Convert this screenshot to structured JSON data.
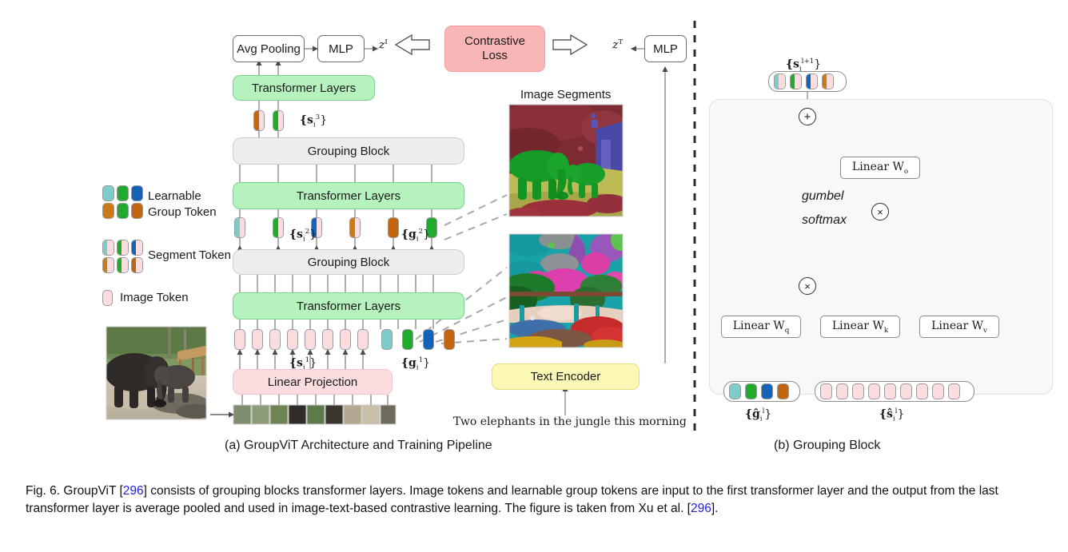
{
  "figure": {
    "number": "Fig. 6.",
    "caption_part1": "GroupViT [",
    "citation1": "296",
    "caption_part2": "] consists of grouping blocks transformer layers. Image tokens and learnable group tokens are input to the first transformer layer and the output from the last transformer layer is average pooled and used in image-text-based contrastive learning. The figure is taken from Xu et al. [",
    "citation2": "296",
    "caption_part3": "]."
  },
  "subcaptions": {
    "a": "(a) GroupViT Architecture and Training Pipeline",
    "b": "(b) Grouping Block"
  },
  "panel_a": {
    "avg_pooling": "Avg Pooling",
    "mlp_image": "MLP",
    "mlp_text": "MLP",
    "z_image": "z",
    "z_image_sup": "I",
    "z_text": "z",
    "z_text_sup": "T",
    "contrastive_loss_line1": "Contrastive",
    "contrastive_loss_line2": "Loss",
    "transformer_layers_top": "Transformer Layers",
    "transformer_layers_mid": "Transformer Layers",
    "transformer_layers_bot": "Transformer Layers",
    "grouping_block_top": "Grouping Block",
    "grouping_block_bot": "Grouping Block",
    "linear_projection": "Linear Projection",
    "text_encoder": "Text Encoder",
    "text_caption": "Two elephants in the jungle this morning",
    "image_segments_title": "Image Segments",
    "label_s3": "{s",
    "label_s3_sub": "i",
    "label_s3_sup": "3",
    "label_s2": "{s",
    "label_s2_sub": "i",
    "label_s2_sup": "2",
    "label_g2": "{g",
    "label_g2_sub": "i",
    "label_g2_sup": "2",
    "label_s1": "{s",
    "label_s1_sub": "i",
    "label_s1_sup": "1",
    "label_g1": "{g",
    "label_g1_sub": "i",
    "label_g1_sup": "1",
    "brace_close": "}"
  },
  "panel_b": {
    "output_label": "{s",
    "output_sub": "i",
    "output_sup": "l+1",
    "linear_wo": "Linear W",
    "linear_wo_sub": "o",
    "linear_wq": "Linear W",
    "linear_wq_sub": "q",
    "linear_wk": "Linear W",
    "linear_wk_sub": "k",
    "linear_wv": "Linear W",
    "linear_wv_sub": "v",
    "gumbel": "gumbel",
    "softmax": "softmax",
    "plus_op": "+",
    "times_op": "×",
    "input_g_label": "{ĝ",
    "input_g_sub": "i",
    "input_g_sup": "l",
    "input_s_label": "{ŝ",
    "input_s_sub": "i",
    "input_s_sup": "l",
    "brace_close": "}"
  },
  "legend": {
    "items": [
      {
        "name": "learnable-group-token",
        "label_line1": "Learnable",
        "label_line2": "Group Token"
      },
      {
        "name": "segment-token",
        "label_line1": "Segment Token",
        "label_line2": ""
      },
      {
        "name": "image-token",
        "label_line1": "Image Token",
        "label_line2": ""
      }
    ]
  },
  "colors": {
    "teal": "#7ecbc9",
    "green": "#22aa2e",
    "blue": "#1563b8",
    "orange": "#cc7a16",
    "orange_dark": "#c4640e",
    "image_token_pink": "#fbdde0",
    "contrastive_loss_bg": "#f9b6b6",
    "transformer_bg": "#b6f2be",
    "grouping_bg": "#ecedef",
    "linear_proj_bg": "#fbdde0",
    "text_encoder_bg": "#fbf7b4",
    "citation_link": "#2323dd"
  },
  "tokens": {
    "row_s3": [
      "orange",
      "green"
    ],
    "row_s2_segments": [
      "teal",
      "green",
      "blue",
      "orange"
    ],
    "row_g2_groups": [
      "orange_dark",
      "green"
    ],
    "row_g1_groups": [
      "teal",
      "green",
      "blue",
      "orange_dark"
    ],
    "row_s1_image_count": 8,
    "panel_b_output": [
      "teal",
      "green",
      "blue",
      "orange"
    ],
    "panel_b_input_g": [
      "teal",
      "green",
      "blue",
      "orange_dark"
    ],
    "panel_b_input_s_count": 9,
    "image_patch_count": 9
  }
}
